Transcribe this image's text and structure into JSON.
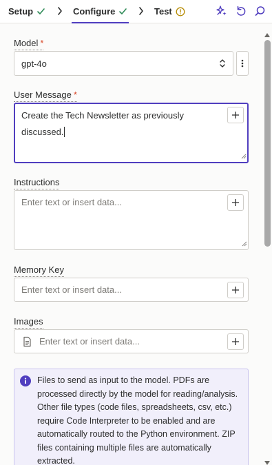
{
  "steps": [
    {
      "label": "Setup",
      "status": "complete"
    },
    {
      "label": "Configure",
      "status": "complete"
    },
    {
      "label": "Test",
      "status": "warning"
    }
  ],
  "toolbar_icons": [
    "sparkle-icon",
    "undo-icon",
    "search-icon"
  ],
  "fields": {
    "model": {
      "label": "Model",
      "required_mark": "*",
      "value": "gpt-4o"
    },
    "user_message": {
      "label": "User Message",
      "required_mark": "*",
      "value": "Create the Tech Newsletter as previously discussed."
    },
    "instructions": {
      "label": "Instructions",
      "placeholder": "Enter text or insert data..."
    },
    "memory_key": {
      "label": "Memory Key",
      "placeholder": "Enter text or insert data..."
    },
    "images": {
      "label": "Images",
      "placeholder": "Enter text or insert data..."
    }
  },
  "info_box": {
    "text": "Files to send as input to the model. PDFs are processed directly by the model for reading/analysis. Other file types (code files, spreadsheets, csv, etc.) require Code Interpreter to be enabled and are automatically routed to the Python environment. ZIP files containing multiple files are automatically extracted."
  },
  "colors": {
    "accent": "#503ebf",
    "success": "#2e8b57",
    "warning": "#b58a00",
    "required": "#d94a2b",
    "info_bg": "#f1effb"
  }
}
